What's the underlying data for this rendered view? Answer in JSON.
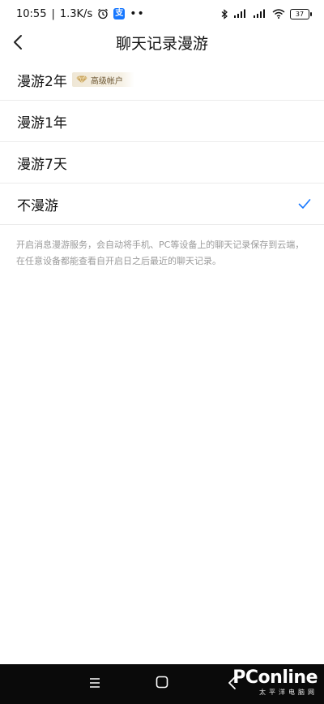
{
  "status_bar": {
    "time": "10:55",
    "speed": "1.3K/s",
    "alipay_glyph": "支",
    "battery": "37",
    "icons": [
      "alarm-icon",
      "alipay-icon",
      "more-dots-icon",
      "bluetooth-icon",
      "signal-icon",
      "wifi-icon",
      "battery-icon"
    ]
  },
  "header": {
    "title": "聊天记录漫游"
  },
  "options": [
    {
      "label": "漫游2年",
      "badge": "高级帐户",
      "selected": false
    },
    {
      "label": "漫游1年",
      "selected": false
    },
    {
      "label": "漫游7天",
      "selected": false
    },
    {
      "label": "不漫游",
      "selected": true
    }
  ],
  "description": "开启消息漫游服务，会自动将手机、PC等设备上的聊天记录保存到云端，在任意设备都能查看自开启日之后最近的聊天记录。",
  "watermark": {
    "main": "PConline",
    "sub": "太平洋电脑网"
  },
  "colors": {
    "accent": "#1677ff",
    "check": "#1677ff",
    "badge_text": "#6b5531",
    "desc_text": "#9a9a9a"
  }
}
